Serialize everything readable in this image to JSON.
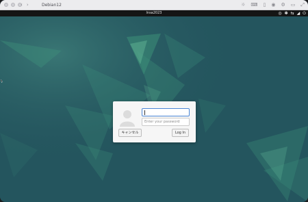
{
  "window": {
    "title": "Debian12"
  },
  "topbar": {
    "clock": "lnsa2023"
  },
  "login": {
    "username_value": "",
    "password_placeholder": "Enter your password",
    "cancel_label": "キャンセル",
    "login_label": "Log In"
  },
  "colors": {
    "desktop_background": "#24555e",
    "accent_green": "#2f8a6e",
    "topbar": "#151515",
    "focus_border": "#4a86d6"
  }
}
